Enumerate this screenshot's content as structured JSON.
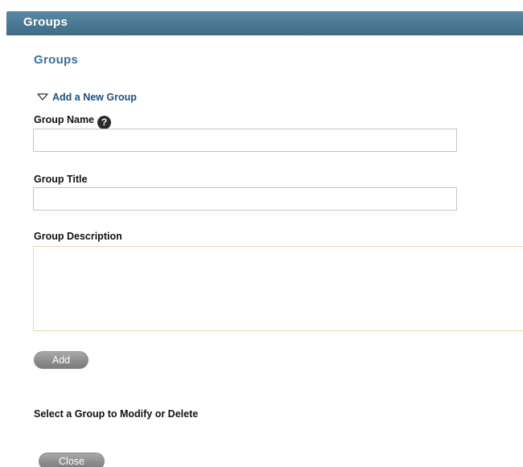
{
  "window": {
    "title": "Groups"
  },
  "main": {
    "section_title": "Groups",
    "add_toggle_label": "Add a New Group",
    "form": {
      "group_name_label": "Group Name",
      "group_name_value": "",
      "group_title_label": "Group Title",
      "group_title_value": "",
      "group_description_label": "Group Description",
      "group_description_value": "",
      "help_icon_glyph": "?"
    },
    "add_button_label": "Add",
    "select_prompt": "Select a Group to Modify or Delete",
    "close_button_label": "Close"
  },
  "icons": {
    "toggle": "triangle-down-icon",
    "help": "help-icon"
  },
  "colors": {
    "titlebar": "#4a7893",
    "section_title": "#3c6f9f",
    "link": "#1d4e7e",
    "button": "#8d8d8d"
  }
}
